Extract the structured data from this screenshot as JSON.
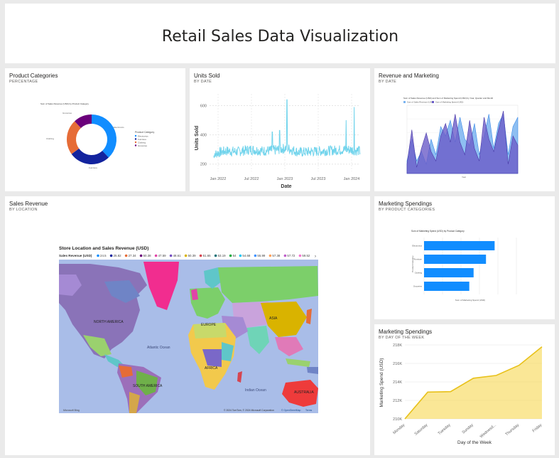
{
  "page_title": "Retail Sales Data Visualization",
  "colors": {
    "line_light": "#72d4ec",
    "bar_blue": "#118dff",
    "donut": [
      "#118dff",
      "#12239e",
      "#e66c37",
      "#6b007b"
    ],
    "area_yellow": "#f5d33f",
    "area_purple": "#6b5cc8",
    "area_lightblue": "#7ab4f0"
  },
  "cards": {
    "product_categories": {
      "title": "Product Categories",
      "subtitle": "PERCENTAGE",
      "inner_title": "Sum of Sales Revenue (USD) by Product Category",
      "legend_title": "Product Category",
      "legend_items": [
        "Electronics",
        "Furniture",
        "Clothing",
        "Groceries"
      ],
      "slice_labels": [
        "Electronics",
        "Furniture",
        "Clothing",
        "Groceries"
      ]
    },
    "units_sold": {
      "title": "Units Sold",
      "subtitle": "BY DATE",
      "xlabel": "Date",
      "ylabel": "Units Sold"
    },
    "revenue_marketing": {
      "title": "Revenue and Marketing",
      "subtitle": "BY DATE",
      "inner_title": "Sum of Sales Revenue (USD) and Sum of Marketing Spend (USD) by Year, Quarter and Month",
      "legend_items": [
        "Sum of Sales Revenue (USD)",
        "Sum of Marketing Spend (USD)"
      ],
      "xlabel": "Year"
    },
    "sales_revenue": {
      "title": "Sales Revenue",
      "subtitle": "BY LOCATION",
      "map_title": "Store Location and Sales Revenue (USD)",
      "legend_label": "Sales Revenue (USD)",
      "legend_values": [
        "24.5",
        "25.82",
        "27.34",
        "50.38",
        "47.59",
        "48.61",
        "50.39",
        "51.65",
        "53.19",
        "54",
        "54.68",
        "55.99",
        "57.38",
        "57.72",
        "59.52"
      ],
      "legend_colors": [
        "#118dff",
        "#12239e",
        "#e66c37",
        "#6b007b",
        "#e044a7",
        "#744ec2",
        "#d9b300",
        "#d64550",
        "#197278",
        "#1aab40",
        "#15c6f4",
        "#4092ff",
        "#ffa058",
        "#be5dc9",
        "#f472d0"
      ],
      "continents": [
        "NORTH AMERICA",
        "EUROPE",
        "ASIA",
        "AFRICA",
        "SOUTH AMERICA",
        "AUSTRALIA"
      ],
      "oceans": [
        "Atlantic Ocean",
        "Indian Ocean"
      ],
      "bing_label": "Microsoft Bing",
      "copyright": "© 2024 TomTom, © 2024 Microsoft Corporation",
      "copyright_link": "© OpenStreetMap",
      "terms": "Terms"
    },
    "marketing_categories": {
      "title": "Marketing Spendings",
      "subtitle": "BY PRODUCT CATEGORIES",
      "inner_title": "Sum of Marketing Spend (USD) by Product Category",
      "xlabel": "Sum of Marketing Spend (USD)",
      "ylabel": "Product Category",
      "categories": [
        "Electronics",
        "Furniture",
        "Clothing",
        "Groceries"
      ]
    },
    "marketing_days": {
      "title": "Marketing Spendings",
      "subtitle": "BY DAY OF THE WEEK",
      "xlabel": "Day of the Week",
      "ylabel": "Marketing Spend (USD)"
    }
  },
  "chart_data": [
    {
      "type": "pie",
      "title": "Sum of Sales Revenue (USD) by Product Category",
      "categories": [
        "Electronics",
        "Furniture",
        "Clothing",
        "Groceries"
      ],
      "values": [
        38,
        27,
        23,
        12
      ]
    },
    {
      "type": "line",
      "xlabel": "Date",
      "ylabel": "Units Sold",
      "x_ticks": [
        "Jan 2022",
        "Jul 2022",
        "Jan 2023",
        "Jul 2023",
        "Jan 2024"
      ],
      "y_ticks": [
        200,
        400,
        600
      ],
      "ylim": [
        150,
        680
      ],
      "series": [
        {
          "x": [
            "2022-01",
            "2022-03",
            "2022-05",
            "2022-07",
            "2022-09",
            "2022-11",
            "2023-01",
            "2023-03",
            "2023-05",
            "2023-07",
            "2023-09",
            "2023-11",
            "2024-01"
          ],
          "values": [
            270,
            290,
            285,
            300,
            290,
            295,
            310,
            280,
            285,
            290,
            295,
            300,
            290
          ]
        }
      ],
      "spikes": [
        {
          "x": "2022-11",
          "value": 420
        },
        {
          "x": "2022-12",
          "value": 430
        },
        {
          "x": "2022-12-31",
          "value": 640
        },
        {
          "x": "2023-11",
          "value": 500
        },
        {
          "x": "2023-12",
          "value": 590
        }
      ]
    },
    {
      "type": "bar",
      "title": "Sum of Marketing Spend (USD) by Product Category",
      "categories": [
        "Electronics",
        "Furniture",
        "Clothing",
        "Groceries"
      ],
      "values": [
        245,
        215,
        172,
        157
      ],
      "xlim": [
        0,
        250
      ]
    },
    {
      "type": "area",
      "xlabel": "Day of the Week",
      "ylabel": "Marketing Spend (USD)",
      "categories": [
        "Monday",
        "Saturday",
        "Tuesday",
        "Sunday",
        "Wednesd...",
        "Thursday",
        "Friday"
      ],
      "values": [
        210000,
        212900,
        212950,
        214400,
        214700,
        215800,
        217800
      ],
      "y_ticks": [
        "210K",
        "212K",
        "214K",
        "216K",
        "218K"
      ],
      "ylim": [
        210000,
        218000
      ]
    }
  ]
}
